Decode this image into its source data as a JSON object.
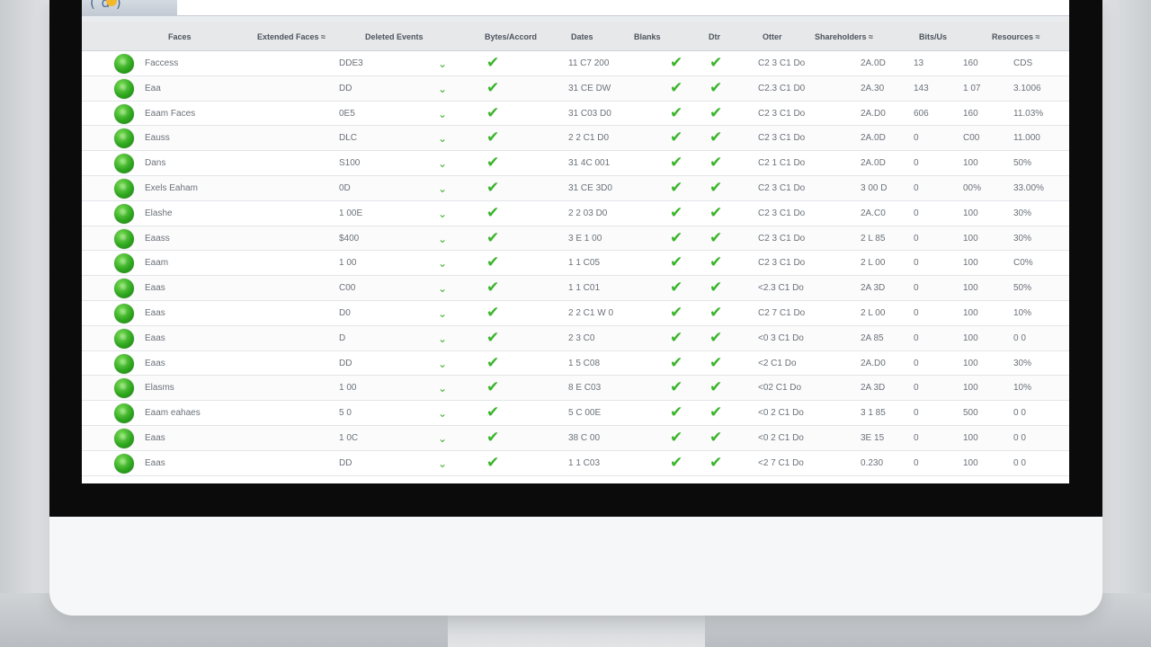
{
  "colors": {
    "bezel": "#0b0b0c",
    "status_ok": "#2fa71f",
    "check": "#39b52a",
    "header_bg": "#e6e8ea"
  },
  "app": {
    "logo_text": "( ɑ )"
  },
  "table": {
    "columns": [
      "Faces",
      "Extended Faces ≈",
      "Deleted Events",
      "Bytes/Accord",
      "Dates",
      "Blanks",
      "Dtr",
      "Otter",
      "Shareholders ≈",
      "Bits/Us",
      "Resources ≈"
    ],
    "rows": [
      {
        "name": "Faccess",
        "size": "DDE3",
        "date": "11 C7 200",
        "time": "C2 3 C1 Do",
        "sum": "2A.0D",
        "a": "13",
        "b": "160",
        "c": "CDS"
      },
      {
        "name": "Eaa",
        "size": "DD",
        "date": "31 CE DW",
        "time": "C2.3 C1 D0",
        "sum": "2A.30",
        "a": "143",
        "b": "1 07",
        "c": "3.1006"
      },
      {
        "name": "Eaam Faces",
        "size": "0E5",
        "date": "31 C03 D0",
        "time": "C2 3 C1 Do",
        "sum": "2A.D0",
        "a": "606",
        "b": "160",
        "c": "11.03%"
      },
      {
        "name": "Eauss",
        "size": "DLC",
        "date": "2 2 C1 D0",
        "time": "C2 3 C1 Do",
        "sum": "2A.0D",
        "a": "0",
        "b": "C00",
        "c": "11.000"
      },
      {
        "name": "Dans",
        "size": "S100",
        "date": "31 4C 001",
        "time": "C2 1 C1 Do",
        "sum": "2A.0D",
        "a": "0",
        "b": "100",
        "c": "50%"
      },
      {
        "name": "Exels Eaham",
        "size": "0D",
        "date": "31 CE 3D0",
        "time": "C2 3 C1 Do",
        "sum": "3 00 D",
        "a": "0",
        "b": "00%",
        "c": "33.00%"
      },
      {
        "name": "Elashe",
        "size": "1 00E",
        "date": "2 2 03 D0",
        "time": "C2 3 C1 Do",
        "sum": "2A.C0",
        "a": "0",
        "b": "100",
        "c": "30%"
      },
      {
        "name": "Eaass",
        "size": "$400",
        "date": "3 E 1 00",
        "time": "C2 3 C1 Do",
        "sum": "2 L 85",
        "a": "0",
        "b": "100",
        "c": "30%"
      },
      {
        "name": "Eaam",
        "size": "1 00",
        "date": "1 1 C05",
        "time": "C2 3 C1 Do",
        "sum": "2 L 00",
        "a": "0",
        "b": "100",
        "c": "C0%"
      },
      {
        "name": "Eaas",
        "size": "C00",
        "date": "1 1 C01",
        "time": "<2.3 C1 Do",
        "sum": "2A 3D",
        "a": "0",
        "b": "100",
        "c": "50%"
      },
      {
        "name": "Eaas",
        "size": "D0",
        "date": "2 2 C1 W 0",
        "time": "C2 7 C1 Do",
        "sum": "2 L 00",
        "a": "0",
        "b": "100",
        "c": "10%"
      },
      {
        "name": "Eaas",
        "size": "D",
        "date": "2 3 C0",
        "time": "<0 3 C1 Do",
        "sum": "2A 85",
        "a": "0",
        "b": "100",
        "c": "0 0"
      },
      {
        "name": "Eaas",
        "size": "DD",
        "date": "1 5 C08",
        "time": "<2 C1 Do",
        "sum": "2A.D0",
        "a": "0",
        "b": "100",
        "c": "30%"
      },
      {
        "name": "Elasms",
        "size": "1 00",
        "date": "8 E C03",
        "time": "<02 C1 Do",
        "sum": "2A 3D",
        "a": "0",
        "b": "100",
        "c": "10%"
      },
      {
        "name": "Eaam eahaes",
        "size": "5 0",
        "date": "5 C 00E",
        "time": "<0 2 C1 Do",
        "sum": "3 1 85",
        "a": "0",
        "b": "500",
        "c": "0 0"
      },
      {
        "name": "Eaas",
        "size": "1 0C",
        "date": "38 C 00",
        "time": "<0 2 C1 Do",
        "sum": "3E 15",
        "a": "0",
        "b": "100",
        "c": "0 0"
      },
      {
        "name": "Eaas",
        "size": "DD",
        "date": "1 1 C03",
        "time": "<2 7 C1 Do",
        "sum": "0.230",
        "a": "0",
        "b": "100",
        "c": "0 0"
      }
    ]
  }
}
